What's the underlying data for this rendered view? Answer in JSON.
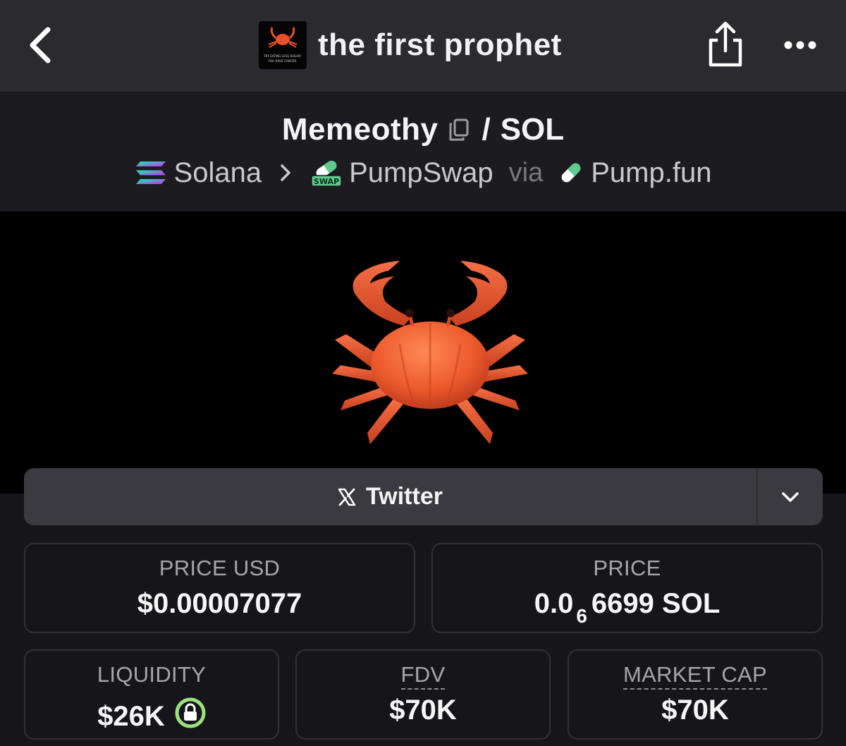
{
  "header": {
    "title": "the first prophet",
    "avatar_caption": [
      "TRY EATING LESS SUGAR!",
      "YOU HAVE CANCER."
    ],
    "icons": [
      "back-chevron-icon",
      "share-icon",
      "more-icon"
    ]
  },
  "pair": {
    "token": "Memeothy",
    "separator": "/",
    "quote": "SOL",
    "route": {
      "chain": "Solana",
      "dex": "PumpSwap",
      "dex_badge": "SWAP",
      "via": "via",
      "launchpad": "Pump.fun"
    }
  },
  "socials": {
    "twitter_label": "Twitter"
  },
  "stats": {
    "price_usd": {
      "label": "PRICE USD",
      "value": "$0.00007077"
    },
    "price": {
      "label": "PRICE",
      "value_prefix": "0.0",
      "value_subscript": "6",
      "value_suffix": "6699 SOL"
    },
    "liquidity": {
      "label": "LIQUIDITY",
      "value": "$26K"
    },
    "fdv": {
      "label": "FDV",
      "value": "$70K"
    },
    "market_cap": {
      "label": "MARKET CAP",
      "value": "$70K"
    }
  },
  "colors": {
    "topbar": "#2a2a2f",
    "background": "#17171b",
    "card_border": "#303036",
    "lock_green": "#9be37f",
    "crab": "#e8502a"
  }
}
